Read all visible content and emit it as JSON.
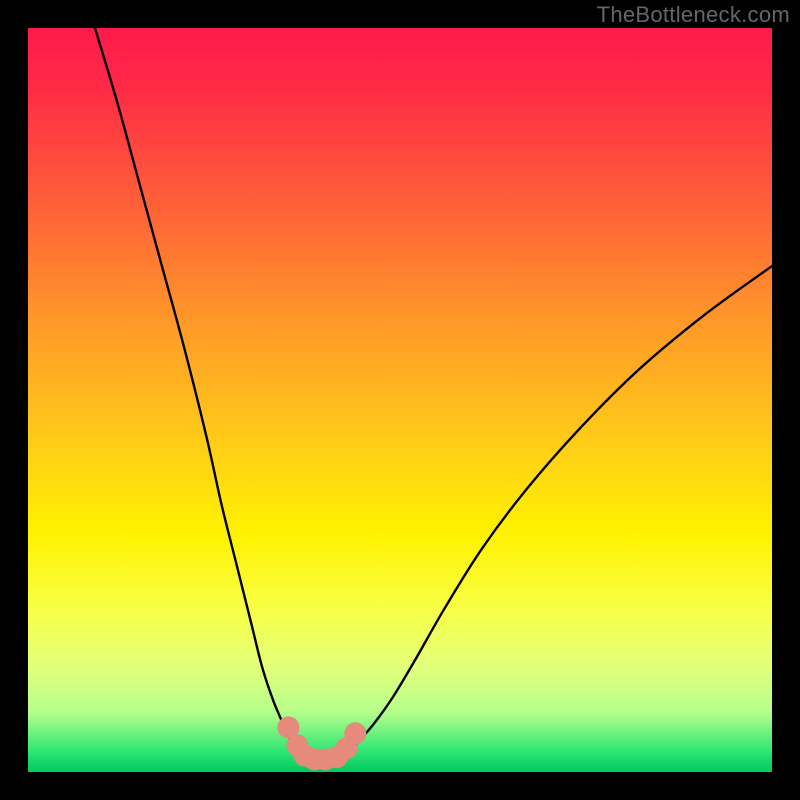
{
  "watermark": "TheBottleneck.com",
  "chart_data": {
    "type": "line",
    "title": "",
    "xlabel": "",
    "ylabel": "",
    "xlim": [
      0,
      100
    ],
    "ylim": [
      0,
      100
    ],
    "background_gradient": {
      "stops": [
        {
          "pos": 0.0,
          "color": "#ff1a4b"
        },
        {
          "pos": 0.08,
          "color": "#ff2a46"
        },
        {
          "pos": 0.22,
          "color": "#ff5a3a"
        },
        {
          "pos": 0.4,
          "color": "#ff9a28"
        },
        {
          "pos": 0.55,
          "color": "#ffca18"
        },
        {
          "pos": 0.68,
          "color": "#fff200"
        },
        {
          "pos": 0.78,
          "color": "#f8ff44"
        },
        {
          "pos": 0.86,
          "color": "#e2ff7a"
        },
        {
          "pos": 0.92,
          "color": "#b4ff8c"
        },
        {
          "pos": 0.975,
          "color": "#28e472"
        },
        {
          "pos": 1.0,
          "color": "#00c95e"
        }
      ]
    },
    "series": [
      {
        "name": "curve-left",
        "x": [
          9,
          12,
          15,
          18,
          21,
          24,
          26,
          28,
          30,
          31.5,
          33,
          34.5,
          35.5,
          36.5,
          37.2
        ],
        "y": [
          100,
          90,
          79,
          68,
          57,
          45,
          36,
          28,
          20,
          14,
          9.5,
          6,
          3.8,
          2.5,
          2.0
        ]
      },
      {
        "name": "curve-right",
        "x": [
          41.8,
          43,
          44.5,
          46.5,
          49,
          52,
          56,
          61,
          67,
          74,
          82,
          91,
          100
        ],
        "y": [
          2.0,
          2.8,
          4.2,
          6.5,
          10,
          15,
          22,
          30,
          38,
          46,
          54,
          61.5,
          68
        ]
      }
    ],
    "valley_markers": {
      "color": "#e58a7c",
      "points": [
        {
          "x": 35.0,
          "y": 6.0
        },
        {
          "x": 36.2,
          "y": 3.6
        },
        {
          "x": 37.2,
          "y": 2.2
        },
        {
          "x": 38.5,
          "y": 1.7
        },
        {
          "x": 40.0,
          "y": 1.7
        },
        {
          "x": 41.5,
          "y": 2.0
        },
        {
          "x": 42.8,
          "y": 3.2
        },
        {
          "x": 44.0,
          "y": 5.2
        }
      ],
      "radius": 11
    }
  }
}
